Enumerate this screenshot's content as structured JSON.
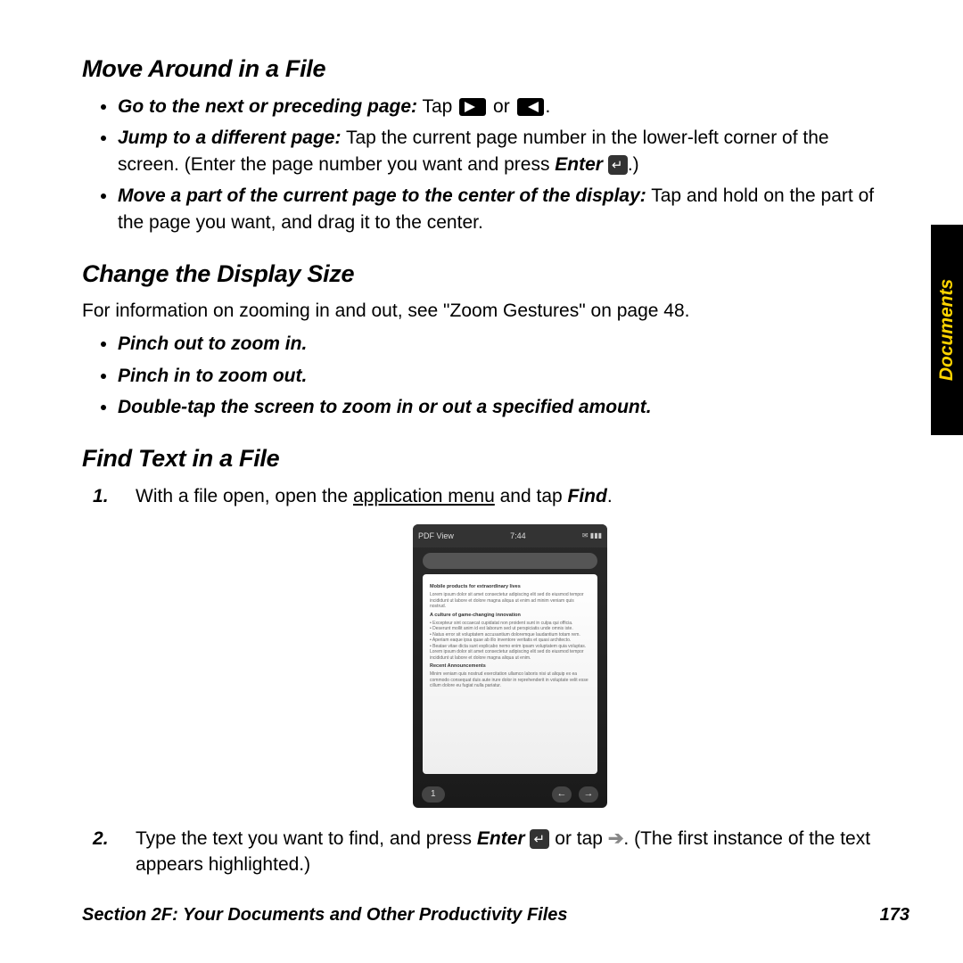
{
  "sidebar_label": "Documents",
  "h1": "Move Around in a File",
  "s1": {
    "b1_a": "Go to the next or preceding page:",
    "b1_b": " Tap ",
    "b1_c": " or ",
    "b1_d": ".",
    "b2_a": "Jump to a different page:",
    "b2_b": " Tap the current page number in the lower-left corner of the screen. (Enter the page number you want and press ",
    "b2_c": "Enter",
    "b2_d": " ",
    "b2_e": ".)",
    "b3_a": "Move a part of the current page to the center of the display:",
    "b3_b": " Tap and hold on the part of the page you want, and drag it to the center."
  },
  "h2": "Change the Display Size",
  "s2": {
    "intro": "For information on zooming in and out, see \"Zoom Gestures\" on page 48.",
    "b1": "Pinch out to zoom in.",
    "b2": "Pinch in to zoom out.",
    "b3": "Double-tap the screen to zoom in or out a specified amount."
  },
  "h3": "Find Text in a File",
  "s3": {
    "step1_a": "With a file open, open the ",
    "step1_b": "application menu",
    "step1_c": " and tap ",
    "step1_d": "Find",
    "step1_e": ".",
    "step2_a": "Type the text you want to find, and press ",
    "step2_b": "Enter",
    "step2_c": " ",
    "step2_d": " or tap ",
    "step2_e": ". (The first instance of the text appears highlighted.)"
  },
  "screenshot": {
    "app": "PDF View",
    "time": "7:44",
    "signal": "✉ ▮▮▮",
    "doc_h1": "Mobile products for extraordinary lives",
    "doc_h2": "A culture of game-changing innovation",
    "doc_h3": "Recent Announcements",
    "page": "1",
    "prev": "←",
    "next": "→"
  },
  "footer_section": "Section 2F: Your Documents and Other Productivity Files",
  "footer_page": "173"
}
